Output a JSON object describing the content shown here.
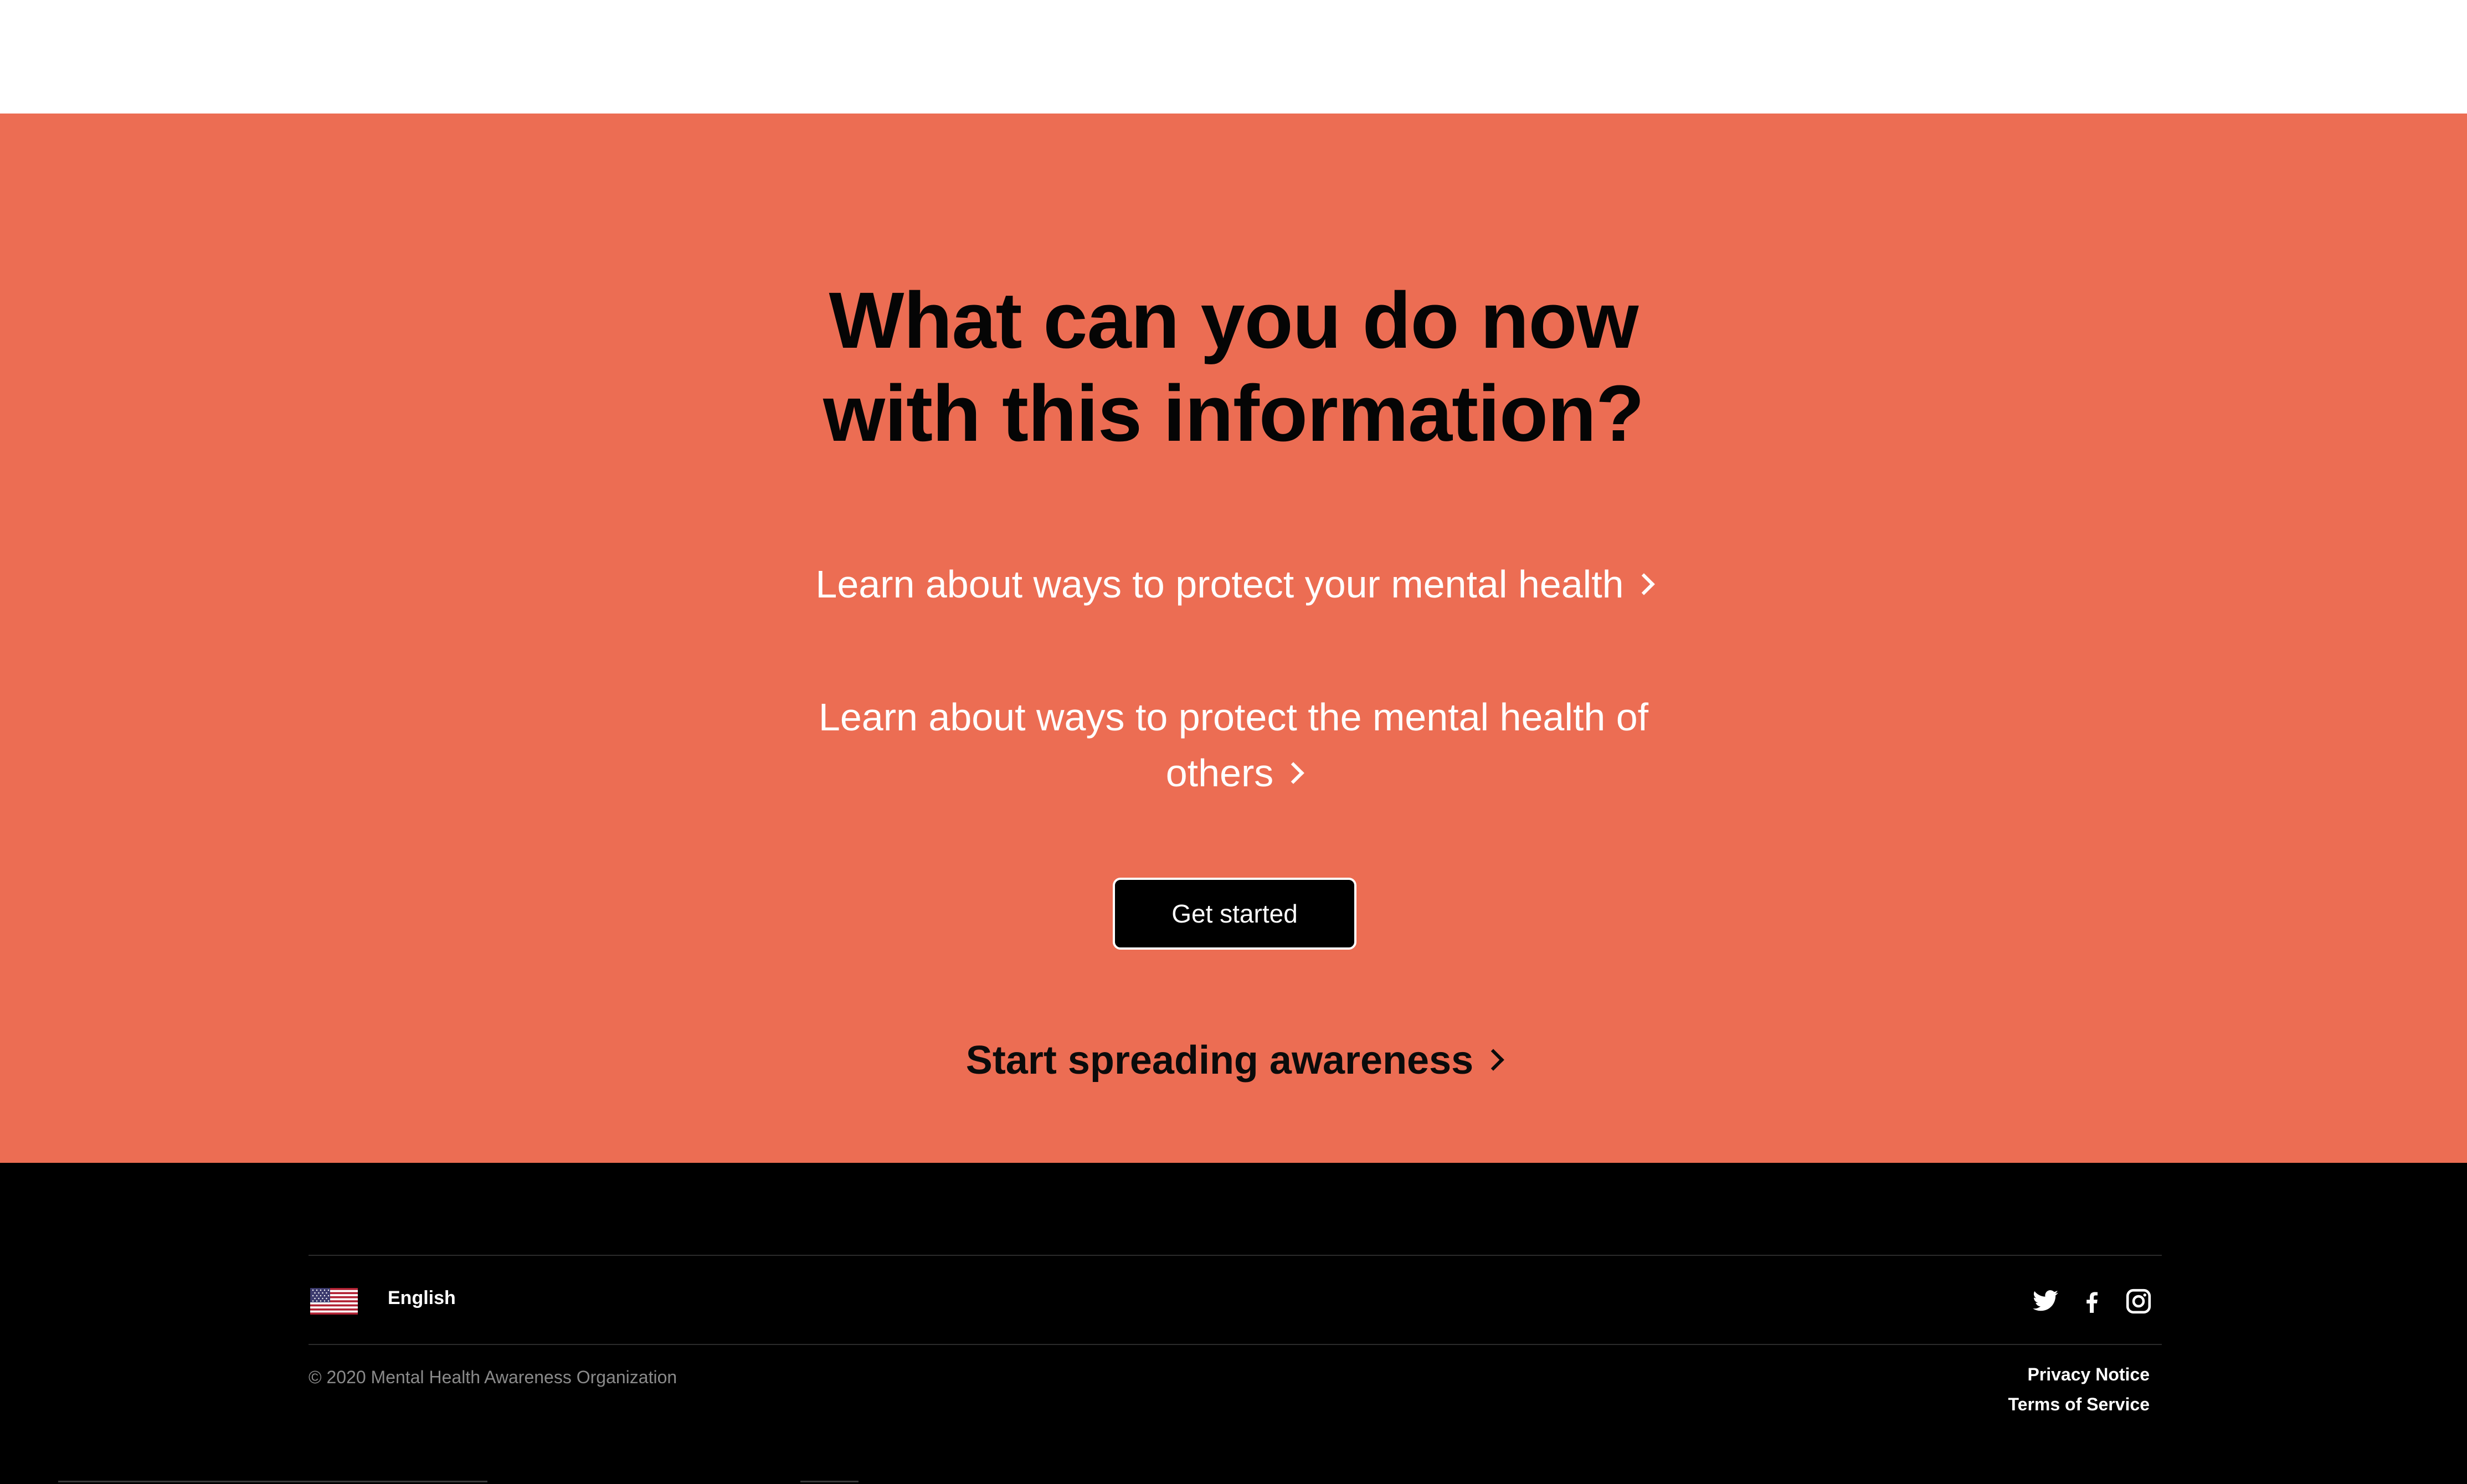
{
  "hero": {
    "title_line1": "What can you do now",
    "title_line2": "with this information?",
    "link1_text": "Learn about ways to protect your mental health",
    "link2_line1": "Learn about ways to protect the mental health of",
    "link2_line2": "others",
    "cta_label": "Get started",
    "spread_text": "Start spreading awareness",
    "icon": "chevron-right-icon"
  },
  "footer": {
    "language": "English",
    "flag_icon": "us-flag-icon",
    "copyright": "© 2020 Mental Health Awareness Organization",
    "privacy_label": "Privacy Notice",
    "terms_label": "Terms of Service",
    "social_icons": [
      "twitter-icon",
      "facebook-icon",
      "instagram-icon"
    ]
  },
  "colors": {
    "hero_bg": "#ec6d53",
    "footer_bg": "#000000",
    "button_bg": "#000000",
    "text_dark": "#050505",
    "text_light": "#ffffff"
  }
}
